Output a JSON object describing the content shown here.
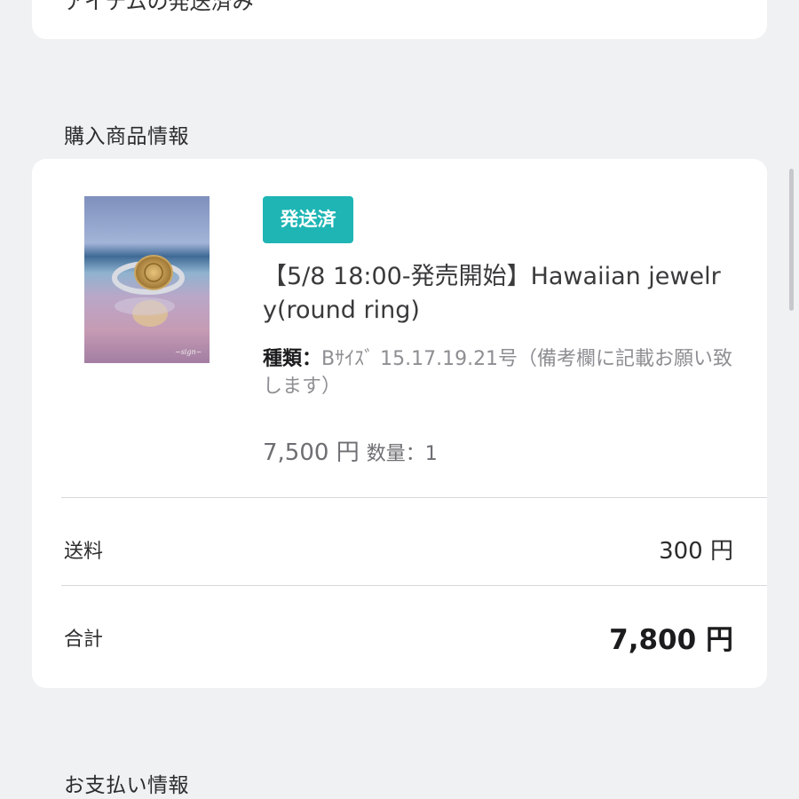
{
  "top_card": {
    "text": "アイテムの発送済み"
  },
  "purchased_items": {
    "heading": "購入商品情報"
  },
  "product": {
    "status_badge": "発送済",
    "title": "【5/8 18:00-発売開始】Hawaiian jewelry(round ring)",
    "variant_label": "種類：",
    "variant_value": "Bｻｲｽﾞ 15.17.19.21号（備考欄に記載お願い致します）",
    "price": "7,500 円",
    "quantity": "数量：1",
    "image_icon": "ring-photo"
  },
  "summary": {
    "shipping_label": "送料",
    "shipping_value": "300 円",
    "total_label": "合計",
    "total_value": "7,800 円"
  },
  "payment": {
    "heading": "お支払い情報"
  },
  "colors": {
    "badge": "#1fb5b5",
    "background": "#f0f1f3",
    "card": "#ffffff"
  }
}
